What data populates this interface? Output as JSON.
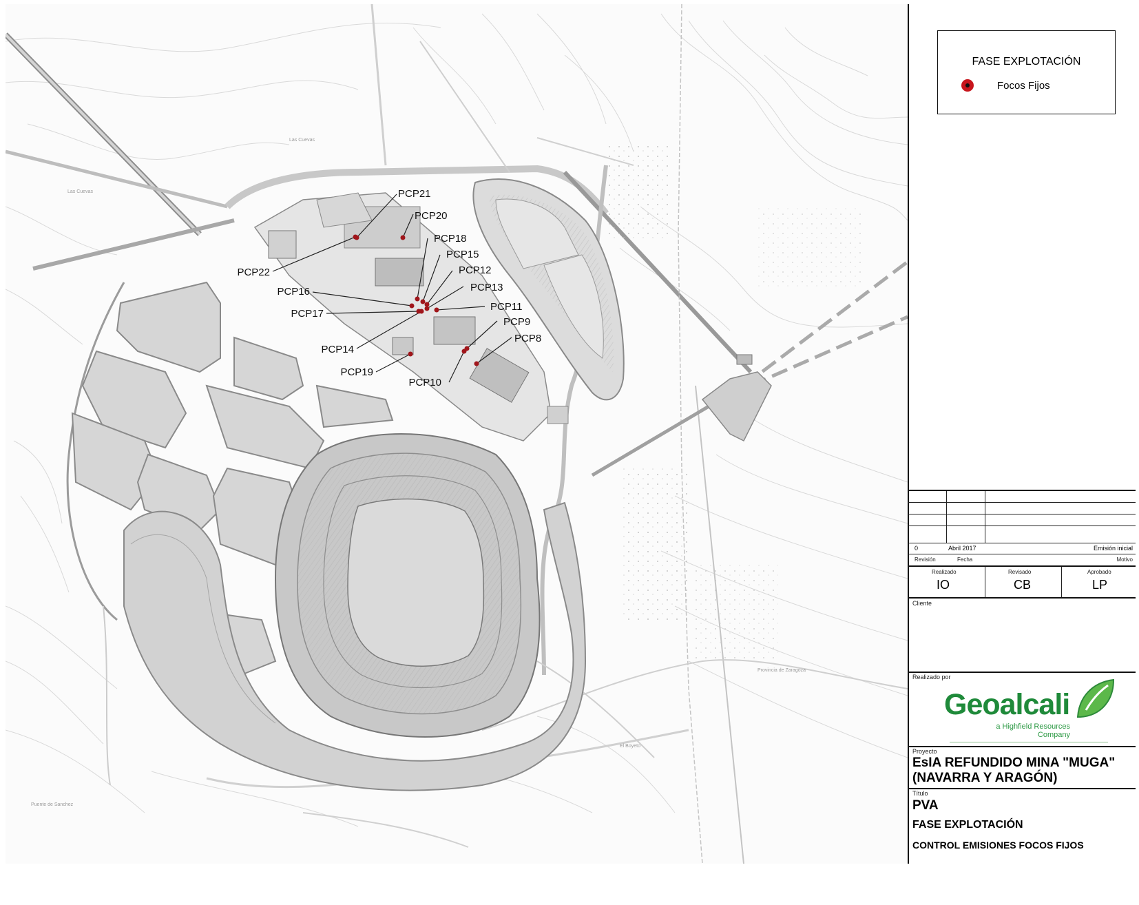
{
  "map": {
    "focus_points": [
      {
        "id": "PCP21",
        "label": "PCP21"
      },
      {
        "id": "PCP20",
        "label": "PCP20"
      },
      {
        "id": "PCP18",
        "label": "PCP18"
      },
      {
        "id": "PCP15",
        "label": "PCP15"
      },
      {
        "id": "PCP12",
        "label": "PCP12"
      },
      {
        "id": "PCP13",
        "label": "PCP13"
      },
      {
        "id": "PCP11",
        "label": "PCP11"
      },
      {
        "id": "PCP9",
        "label": "PCP9"
      },
      {
        "id": "PCP8",
        "label": "PCP8"
      },
      {
        "id": "PCP10",
        "label": "PCP10"
      },
      {
        "id": "PCP19",
        "label": "PCP19"
      },
      {
        "id": "PCP14",
        "label": "PCP14"
      },
      {
        "id": "PCP17",
        "label": "PCP17"
      },
      {
        "id": "PCP16",
        "label": "PCP16"
      },
      {
        "id": "PCP22",
        "label": "PCP22"
      }
    ],
    "place_names": [
      "Las Cuevas",
      "Provincia de Zaragoza",
      "El Boyeto",
      "Puente de Sanchez"
    ],
    "focus_color": "#a0161b"
  },
  "legend": {
    "title": "FASE EXPLOTACIÓN",
    "item_label": "Focos Fijos",
    "item_color": "#c8161d",
    "item_icon": "red-dot-icon"
  },
  "title_block": {
    "revision": {
      "number": "0",
      "date": "Abril 2017",
      "reason": "Emisión inicial",
      "col_revision": "Revisión",
      "col_fecha": "Fecha",
      "col_motivo": "Motivo"
    },
    "signatures": {
      "realizado_label": "Realizado",
      "realizado_value": "IO",
      "revisado_label": "Revisado",
      "revisado_value": "CB",
      "aprobado_label": "Aprobado",
      "aprobado_value": "LP"
    },
    "cliente_label": "Cliente",
    "realizado_por_label": "Realizado por",
    "logo": {
      "name": "Geoalcali",
      "tagline": "a Highfield Resources Company",
      "color": "#1f8a3a"
    },
    "proyecto_label": "Proyecto",
    "proyecto_line1": "EsIA REFUNDIDO MINA \"MUGA\"",
    "proyecto_line2": "(NAVARRA Y ARAGÓN)",
    "titulo_label": "Título",
    "titulo_line1": "PVA",
    "titulo_line2": "FASE EXPLOTACIÓN",
    "titulo_line3": "CONTROL EMISIONES FOCOS FIJOS"
  }
}
